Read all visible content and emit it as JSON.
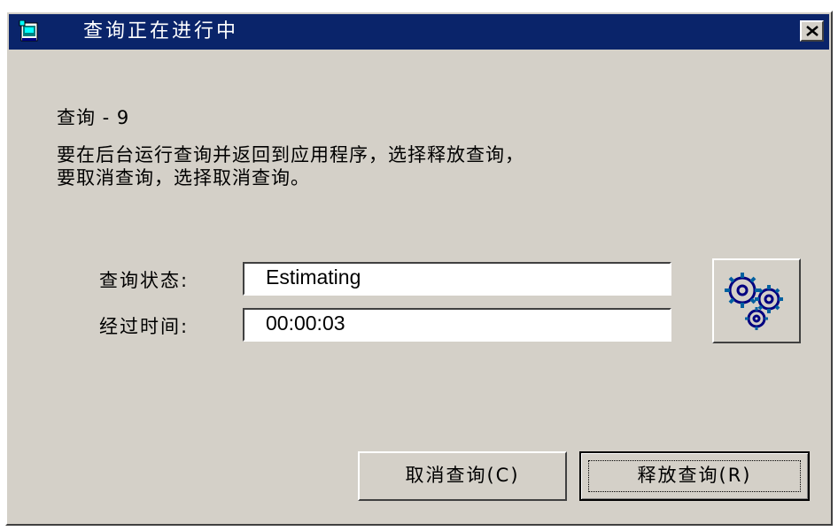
{
  "titlebar": {
    "title": "查询正在进行中",
    "icon": "app-icon",
    "close_icon": "close-icon"
  },
  "message": {
    "query_name": "查询 - 9",
    "line1": "要在后台运行查询并返回到应用程序，选择释放查询，",
    "line2": "要取消查询，选择取消查询。"
  },
  "status": {
    "status_label": "查询状态:",
    "status_value": "Estimating",
    "elapsed_label": "经过时间:",
    "elapsed_value": "00:00:03",
    "animation_icon": "gears-icon"
  },
  "buttons": {
    "cancel_label": "取消查询(C)",
    "release_label": "释放查询(R)"
  },
  "colors": {
    "titlebar_bg": "#0a246a",
    "window_bg": "#d4d0c8"
  }
}
